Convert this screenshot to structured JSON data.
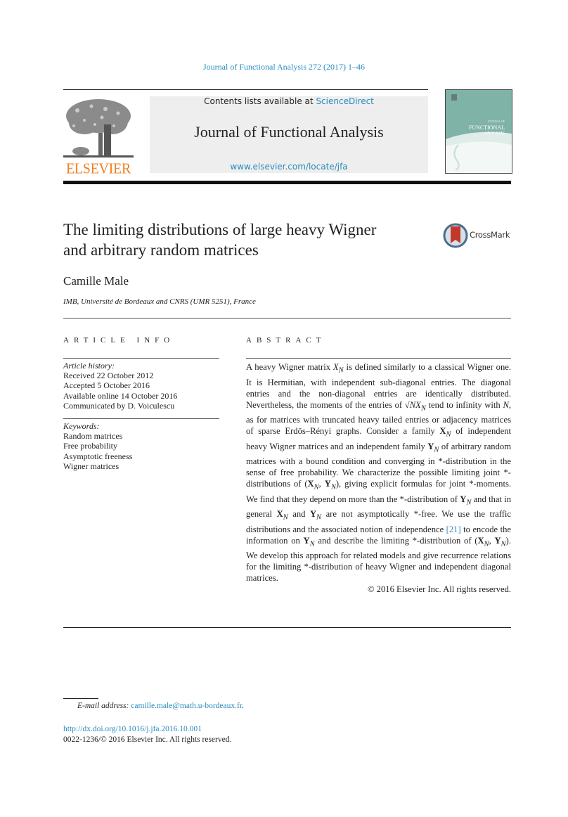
{
  "running_head": "Journal of Functional Analysis 272 (2017) 1–46",
  "publisher": {
    "logo_word": "ELSEVIER",
    "logo_color": "#f07f21"
  },
  "banner": {
    "contents_prefix": "Contents lists available at ",
    "contents_link": "ScienceDirect",
    "journal_title": "Journal of Functional Analysis",
    "url": "www.elsevier.com/locate/jfa"
  },
  "cover": {
    "line1": "JOURNAL OF",
    "line2": "FUNCTIONAL",
    "line3": "ANALYSIS"
  },
  "article": {
    "title_line1": "The limiting distributions of large heavy Wigner",
    "title_line2": "and arbitrary random matrices",
    "crossmark_label": "CrossMark",
    "author": "Camille Male",
    "affiliation": "IMB, Université de Bordeaux and CNRS (UMR 5251), France"
  },
  "article_info": {
    "heading": "ARTICLE INFO",
    "history_label": "Article history:",
    "history": [
      "Received 22 October 2012",
      "Accepted 5 October 2016",
      "Available online 14 October 2016",
      "Communicated by D. Voiculescu"
    ],
    "keywords_label": "Keywords:",
    "keywords": [
      "Random matrices",
      "Free probability",
      "Asymptotic freeness",
      "Wigner matrices"
    ]
  },
  "abstract": {
    "heading": "ABSTRACT",
    "text_1": "A heavy Wigner matrix ",
    "text_2": " is defined similarly to a classical Wigner one. It is Hermitian, with independent sub-diagonal entries. The diagonal entries and the non-diagonal entries are identically distributed. Nevertheless, the moments of the entries of ",
    "text_3": " tend to infinity with ",
    "text_4": ", as for matrices with truncated heavy tailed entries or adjacency matrices of sparse Erdös–Rényi graphs. Consider a family ",
    "text_5": " of independent heavy Wigner matrices and an independent family ",
    "text_6": " of arbitrary random matrices with a bound condition and converging in *-distribution in the sense of free probability. We characterize the possible limiting joint *-distributions of ",
    "text_7": ", giving explicit formulas for joint *-moments. We find that they depend on more than the *-distribution of ",
    "text_8": " and that in general ",
    "text_9": " and ",
    "text_10": " are not asymptotically *-free. We use the traffic distributions and the associated notion of independence ",
    "ref": "[21]",
    "text_11": " to encode the information on ",
    "text_12": " and describe the limiting *-distribution of ",
    "text_13": ". We develop this approach for related models and give recurrence relations for the limiting *-distribution of heavy Wigner and independent diagonal matrices.",
    "copyright": "© 2016 Elsevier Inc. All rights reserved."
  },
  "math": {
    "X": "X",
    "N": "N",
    "sqrtN": "√N",
    "bold_X": "X",
    "bold_Y": "Y",
    "pair_open": "(",
    "pair_comma": ", ",
    "pair_close": ")"
  },
  "footnote": {
    "label": "E-mail address: ",
    "email": "camille.male@math.u-bordeaux.fr",
    "end": "."
  },
  "doi": "http://dx.doi.org/10.1016/j.jfa.2016.10.001",
  "issn_line": "0022-1236/© 2016 Elsevier Inc. All rights reserved.",
  "colors": {
    "link": "#2a8bbf",
    "crossmark_red": "#c0392b",
    "crossmark_blue": "#4a6d8c",
    "cover_teal": "#7fb3a8"
  }
}
